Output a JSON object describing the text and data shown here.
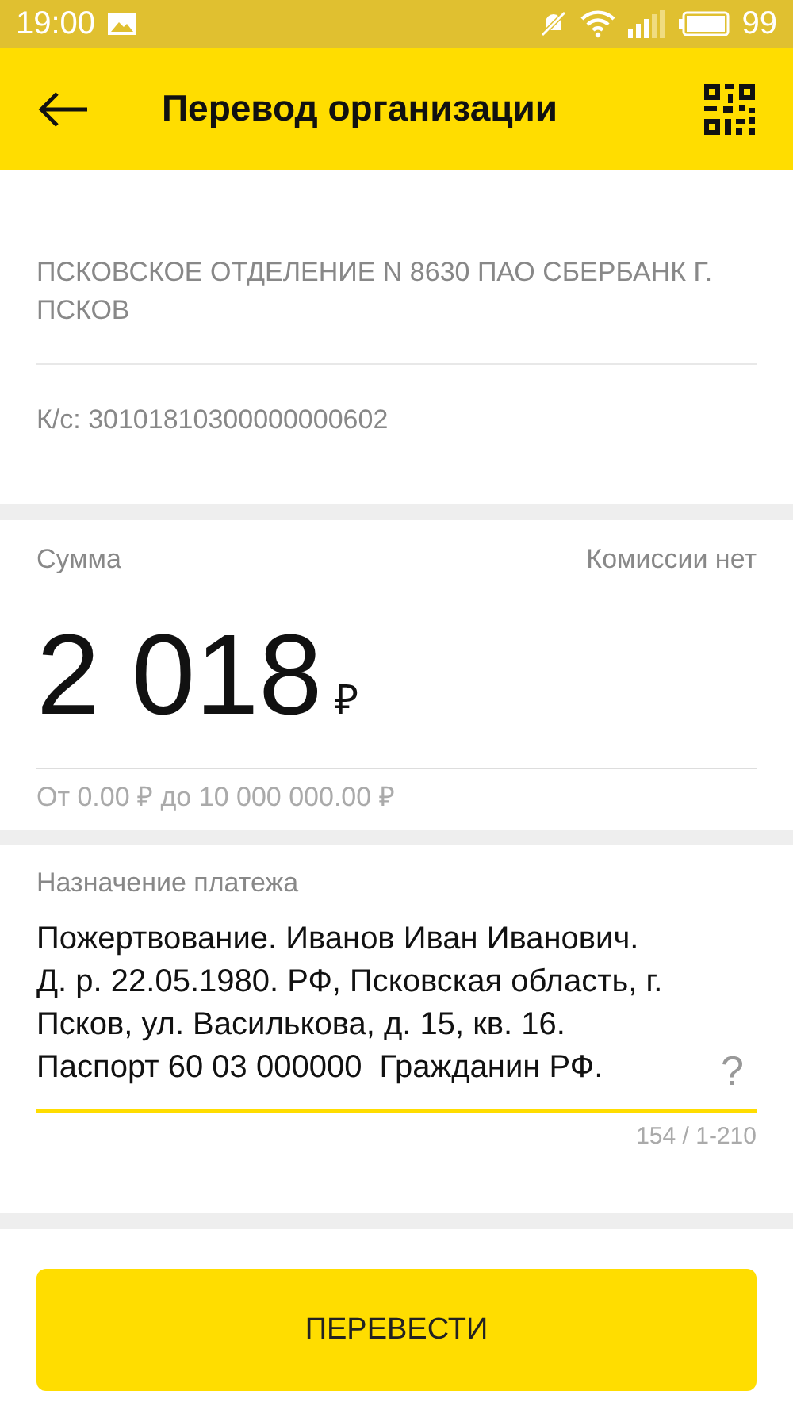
{
  "status_bar": {
    "time": "19:00",
    "battery": "99"
  },
  "header": {
    "title": "Перевод организации"
  },
  "recipient": {
    "bank": "ПСКОВСКОЕ ОТДЕЛЕНИЕ N 8630 ПАО СБЕРБАНК Г. ПСКОВ",
    "account": "К/с: 30101810300000000602"
  },
  "amount": {
    "label": "Сумма",
    "commission": "Комиссии нет",
    "value": "2 018",
    "currency": "₽",
    "limits": "От 0.00 ₽ до 10 000 000.00 ₽"
  },
  "purpose": {
    "label": "Назначение платежа",
    "value": "Пожертвование. Иванов Иван Иванович. Д. р. 22.05.1980. РФ, Псковская область, г. Псков, ул. Василькова, д. 15, кв. 16. Паспорт 60 03 000000  Гражданин РФ.",
    "help": "?",
    "counter": "154 / 1-210"
  },
  "submit_button": "ПЕРЕВЕСТИ"
}
